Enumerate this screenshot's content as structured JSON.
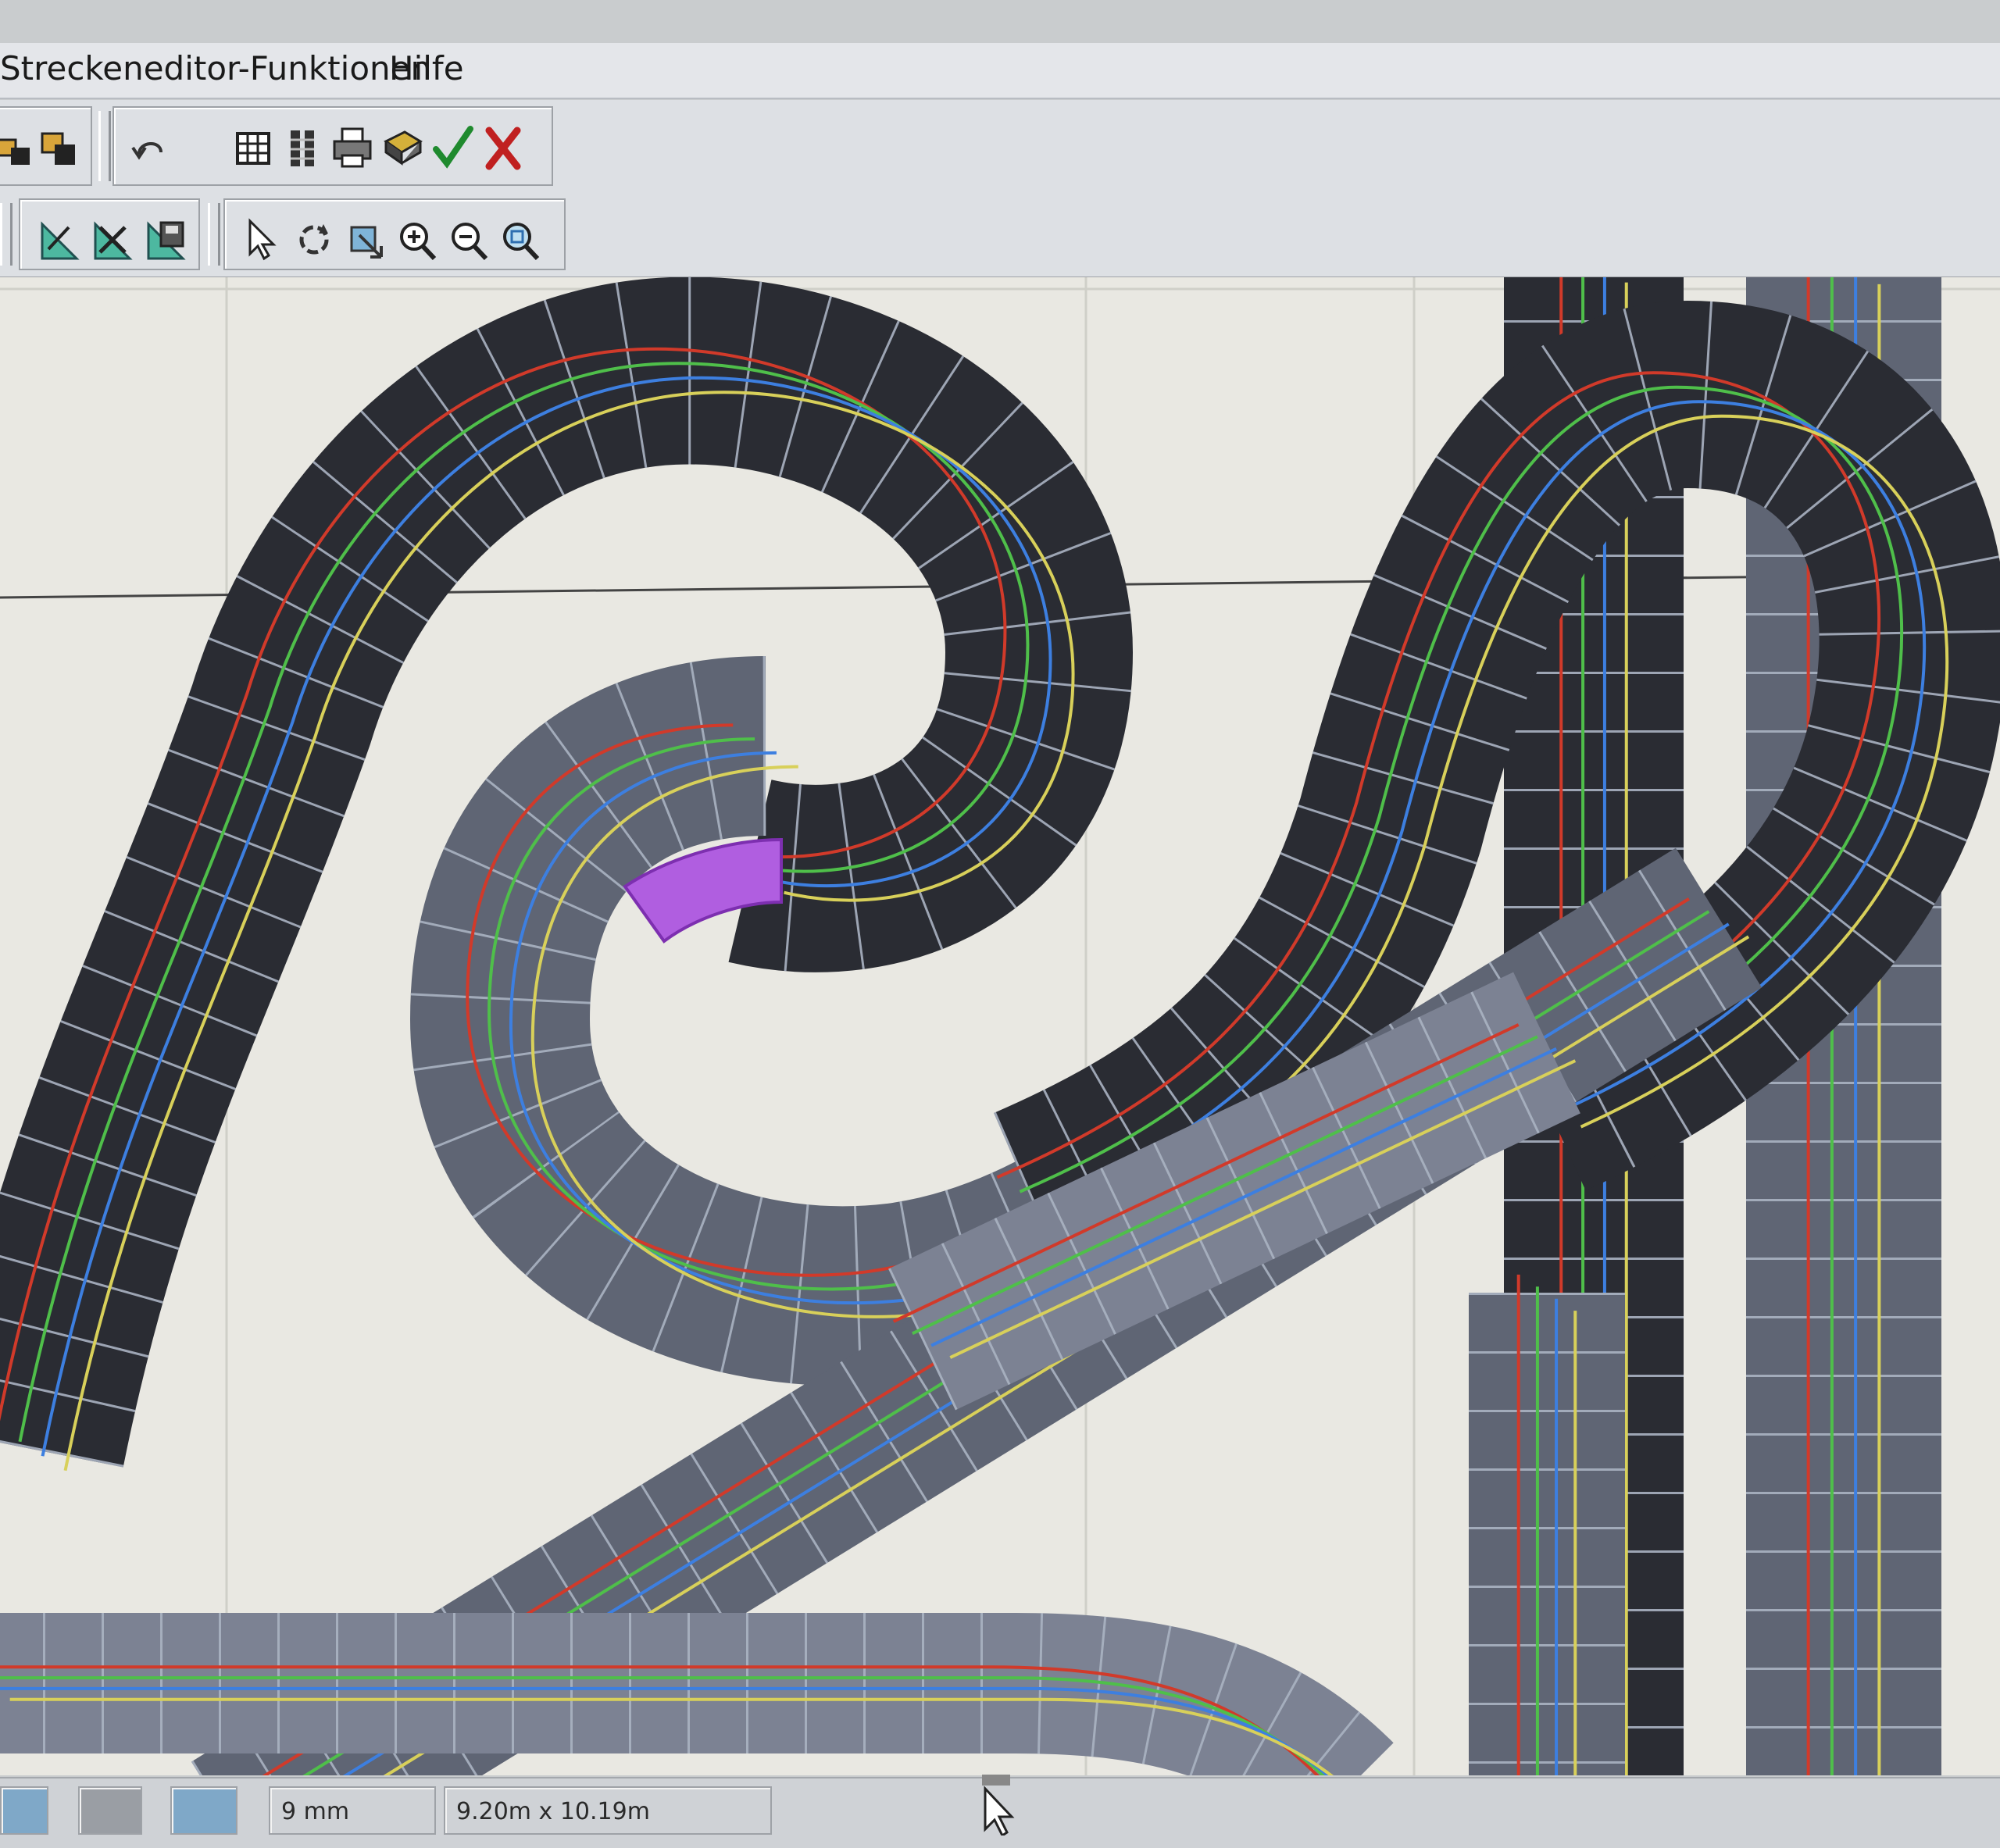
{
  "menu": {
    "items": [
      {
        "label": "Streckeneditor-Funktionen"
      },
      {
        "label": "Hilfe"
      }
    ]
  },
  "toolbar_primary": {
    "buttons": [
      {
        "name": "copy-blocks-icon"
      },
      {
        "name": "paste-blocks-icon"
      },
      {
        "name": "undo-icon"
      },
      {
        "name": "grid-icon"
      },
      {
        "name": "track-pieces-icon"
      },
      {
        "name": "print-icon"
      },
      {
        "name": "book-icon"
      },
      {
        "name": "checkmark-icon"
      },
      {
        "name": "cancel-x-icon"
      }
    ]
  },
  "toolbar_secondary": {
    "buttons": [
      {
        "name": "triangle-edit-icon"
      },
      {
        "name": "triangle-delete-icon"
      },
      {
        "name": "triangle-save-icon"
      },
      {
        "name": "pointer-icon"
      },
      {
        "name": "rotate-icon"
      },
      {
        "name": "move-icon"
      },
      {
        "name": "zoom-in-icon"
      },
      {
        "name": "zoom-out-icon"
      },
      {
        "name": "zoom-fit-icon"
      }
    ]
  },
  "status": {
    "grid_label": "9 mm",
    "dimensions": "9.20m x 10.19m"
  },
  "colors": {
    "canvas": "#e9e8e2",
    "track_dark": "#2a2c33",
    "track_mid": "#5f6574",
    "track_light": "#7c8293",
    "lane_red": "#d13a2a",
    "lane_green": "#4fbf4a",
    "lane_blue": "#3d7fe0",
    "lane_yellow": "#d8d05a",
    "selected": "#b05ee0"
  }
}
